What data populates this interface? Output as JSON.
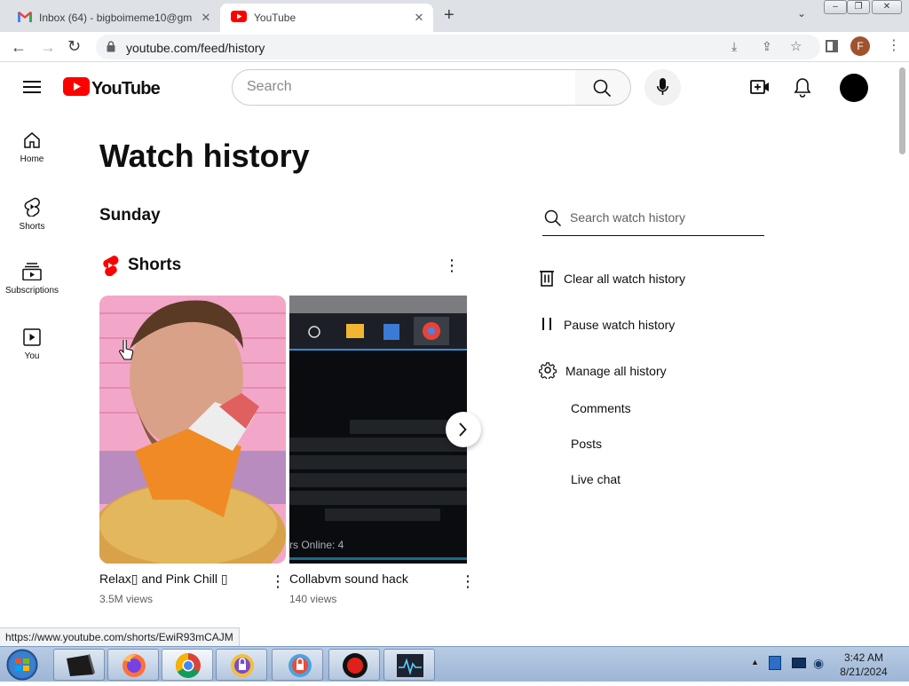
{
  "browser": {
    "tabs": [
      {
        "label": "Inbox (64) - bigboimeme10@gm",
        "favicon": "gmail-icon"
      },
      {
        "label": "YouTube",
        "favicon": "youtube-icon"
      }
    ],
    "url": "youtube.com/feed/history",
    "profile_initial": "F"
  },
  "youtube": {
    "logo_text": "YouTube",
    "search_placeholder": "Search",
    "rail": [
      {
        "label": "Home",
        "icon": "home-icon"
      },
      {
        "label": "Shorts",
        "icon": "shorts-icon"
      },
      {
        "label": "Subscriptions",
        "icon": "subscriptions-icon"
      },
      {
        "label": "You",
        "icon": "you-icon"
      }
    ],
    "page_title": "Watch history",
    "day_heading": "Sunday",
    "shorts_heading": "Shorts",
    "videos": [
      {
        "title": "Relax▯ and Pink Chill ▯",
        "views": "3.5M views"
      },
      {
        "title": "Collabvm sound hack",
        "views": "140 views",
        "thumb_caption": "rs Online: 4"
      }
    ],
    "history_panel": {
      "search_placeholder": "Search watch history",
      "actions": [
        {
          "label": "Clear all watch history",
          "icon": "trash-icon"
        },
        {
          "label": "Pause watch history",
          "icon": "pause-icon"
        },
        {
          "label": "Manage all history",
          "icon": "gear-icon"
        }
      ],
      "sublinks": [
        "Comments",
        "Posts",
        "Live chat"
      ]
    },
    "colors": {
      "brand_red": "#ff0000",
      "text": "#0f0f0f",
      "secondary_text": "#606060"
    }
  },
  "status_url": "https://www.youtube.com/shorts/EwiR93mCAJM",
  "taskbar": {
    "time": "3:42 AM",
    "date": "8/21/2024",
    "apps": [
      "start-orb",
      "tablet-app",
      "firefox",
      "chrome",
      "browser-lock-1",
      "browser-lock-2",
      "record-app",
      "monitor-app"
    ]
  }
}
